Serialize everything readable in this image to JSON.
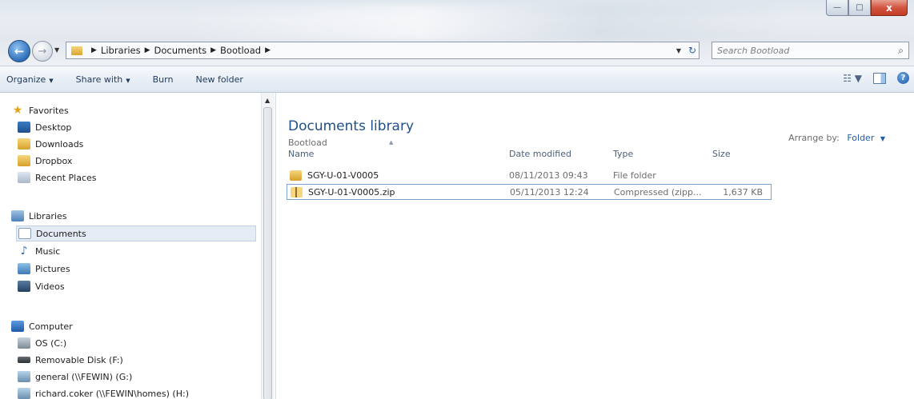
{
  "window": {
    "min": "—",
    "max": "□",
    "close": "x"
  },
  "address": {
    "crumbs": [
      "Libraries",
      "Documents",
      "Bootload"
    ],
    "refresh": "↻"
  },
  "search": {
    "placeholder": "Search Bootload"
  },
  "toolbar": {
    "organize": "Organize",
    "share_with": "Share with",
    "burn": "Burn",
    "new_folder": "New folder"
  },
  "nav": {
    "favorites_header": "Favorites",
    "favorites": [
      {
        "label": "Desktop",
        "icon": "desktop-icon"
      },
      {
        "label": "Downloads",
        "icon": "folder-icon"
      },
      {
        "label": "Dropbox",
        "icon": "folder-icon"
      },
      {
        "label": "Recent Places",
        "icon": "recent-places-icon"
      }
    ],
    "libraries_header": "Libraries",
    "libraries": [
      {
        "label": "Documents",
        "icon": "document-icon",
        "selected": true
      },
      {
        "label": "Music",
        "icon": "music-icon"
      },
      {
        "label": "Pictures",
        "icon": "pictures-icon"
      },
      {
        "label": "Videos",
        "icon": "videos-icon"
      }
    ],
    "computer_header": "Computer",
    "computer": [
      {
        "label": "OS (C:)",
        "icon": "drive-icon"
      },
      {
        "label": "Removable Disk (F:)",
        "icon": "removable-disk-icon"
      },
      {
        "label": "general (\\\\FEWIN) (G:)",
        "icon": "network-drive-icon"
      },
      {
        "label": "richard.coker (\\\\FEWIN\\homes) (H:)",
        "icon": "network-drive-icon"
      }
    ]
  },
  "content": {
    "library_title": "Documents library",
    "library_subtitle": "Bootload",
    "arrange_label": "Arrange by:",
    "arrange_value": "Folder",
    "columns": {
      "name": "Name",
      "date": "Date modified",
      "type": "Type",
      "size": "Size"
    },
    "files": [
      {
        "name": "SGY-U-01-V0005",
        "date": "08/11/2013 09:43",
        "type": "File folder",
        "size": "",
        "icon": "folder-icon"
      },
      {
        "name": "SGY-U-01-V0005.zip",
        "date": "05/11/2013 12:24",
        "type": "Compressed (zipp...",
        "size": "1,637 KB",
        "icon": "zip-folder-icon"
      }
    ]
  }
}
